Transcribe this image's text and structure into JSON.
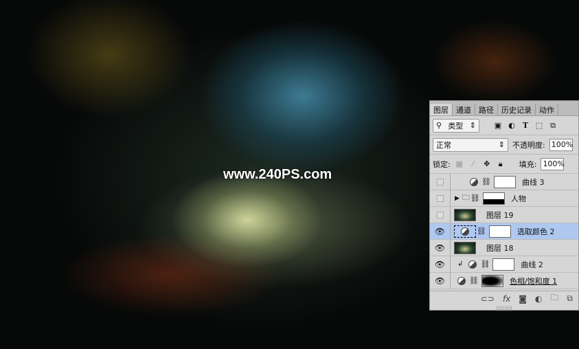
{
  "watermark": "www.240PS.com",
  "panel": {
    "tabs": [
      "图层",
      "通道",
      "路径",
      "历史记录",
      "动作"
    ],
    "filter": {
      "label": "类型",
      "icon": "search-icon"
    },
    "blend_mode": "正常",
    "opacity_label": "不透明度:",
    "opacity": "100%",
    "lock_label": "锁定:",
    "fill_label": "填充:",
    "fill": "100%",
    "layers": [
      {
        "name": "曲线 3",
        "visible": false
      },
      {
        "name": "人物",
        "visible": false
      },
      {
        "name": "图层 19",
        "visible": false
      },
      {
        "name": "选取颜色 2",
        "visible": true,
        "selected": true
      },
      {
        "name": "图层 18",
        "visible": true
      },
      {
        "name": "曲线 2",
        "visible": true
      },
      {
        "name": "色相/饱和度 1",
        "visible": true
      }
    ],
    "bottom_icons": [
      "link-icon",
      "fx-icon",
      "mask-icon",
      "adjustment-icon",
      "folder-icon",
      "new-layer-icon"
    ],
    "fx_label": "fx"
  }
}
